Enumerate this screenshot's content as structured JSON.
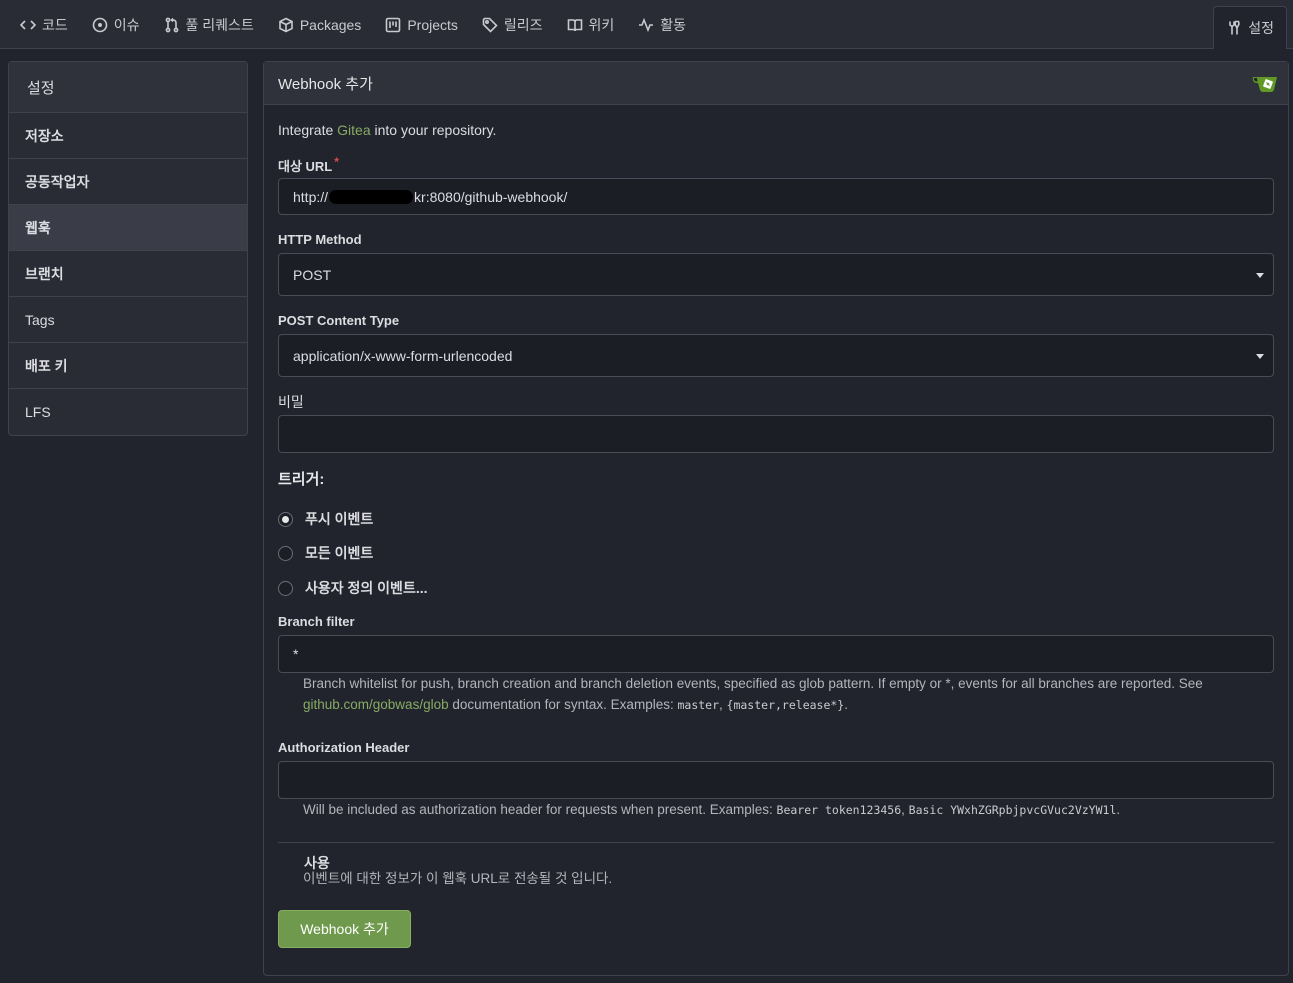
{
  "nav": {
    "items": [
      {
        "label": "코드",
        "icon": "code-icon"
      },
      {
        "label": "이슈",
        "icon": "issue-icon"
      },
      {
        "label": "풀 리퀘스트",
        "icon": "pull-request-icon"
      },
      {
        "label": "Packages",
        "icon": "package-icon"
      },
      {
        "label": "Projects",
        "icon": "project-icon"
      },
      {
        "label": "릴리즈",
        "icon": "tag-icon"
      },
      {
        "label": "위키",
        "icon": "book-icon"
      },
      {
        "label": "활동",
        "icon": "pulse-icon"
      }
    ],
    "settings": {
      "label": "설정",
      "icon": "tools-icon"
    }
  },
  "sidebar": {
    "header": "설정",
    "items": [
      {
        "label": "저장소"
      },
      {
        "label": "공동작업자"
      },
      {
        "label": "웹훅",
        "active": true
      },
      {
        "label": "브랜치"
      },
      {
        "label": "Tags"
      },
      {
        "label": "배포 키"
      },
      {
        "label": "LFS"
      }
    ]
  },
  "form": {
    "title": "Webhook 추가",
    "intro_prefix": "Integrate ",
    "intro_link": "Gitea",
    "intro_suffix": " into your repository.",
    "target_url": {
      "label": "대상 URL",
      "required_mark": "*",
      "value_prefix": "http://",
      "value_suffix": "kr:8080/github-webhook/"
    },
    "http_method": {
      "label": "HTTP Method",
      "value": "POST"
    },
    "content_type": {
      "label": "POST Content Type",
      "value": "application/x-www-form-urlencoded"
    },
    "secret": {
      "label": "비밀",
      "value": ""
    },
    "trigger": {
      "title": "트리거:",
      "options": [
        {
          "label": "푸시 이벤트",
          "checked": true
        },
        {
          "label": "모든 이벤트",
          "checked": false
        },
        {
          "label": "사용자 정의 이벤트...",
          "checked": false
        }
      ]
    },
    "branch_filter": {
      "label": "Branch filter",
      "value": "*",
      "help_1": "Branch whitelist for push, branch creation and branch deletion events, specified as glob pattern. If empty or *, events for all branches are reported. See",
      "help_link": "github.com/gobwas/glob",
      "help_2": " documentation for syntax. Examples: ",
      "example_1": "master",
      "sep": ", ",
      "example_2": "{master,release*}",
      "end": "."
    },
    "auth_header": {
      "label": "Authorization Header",
      "value": "",
      "help": "Will be included as authorization header for requests when present. Examples: ",
      "example_1": "Bearer token123456",
      "sep": ", ",
      "example_2": "Basic YWxhZGRpbjpvcGVuc2VzYW1l",
      "end": "."
    },
    "active": {
      "label": "사용",
      "help": "이벤트에 대한 정보가 이 웹훅 URL로 전송될 것 입니다.",
      "checked": true
    },
    "submit_label": "Webhook 추가"
  },
  "colors": {
    "accent": "#87ab63",
    "button": "#6f9a4d",
    "background": "#22242d"
  }
}
